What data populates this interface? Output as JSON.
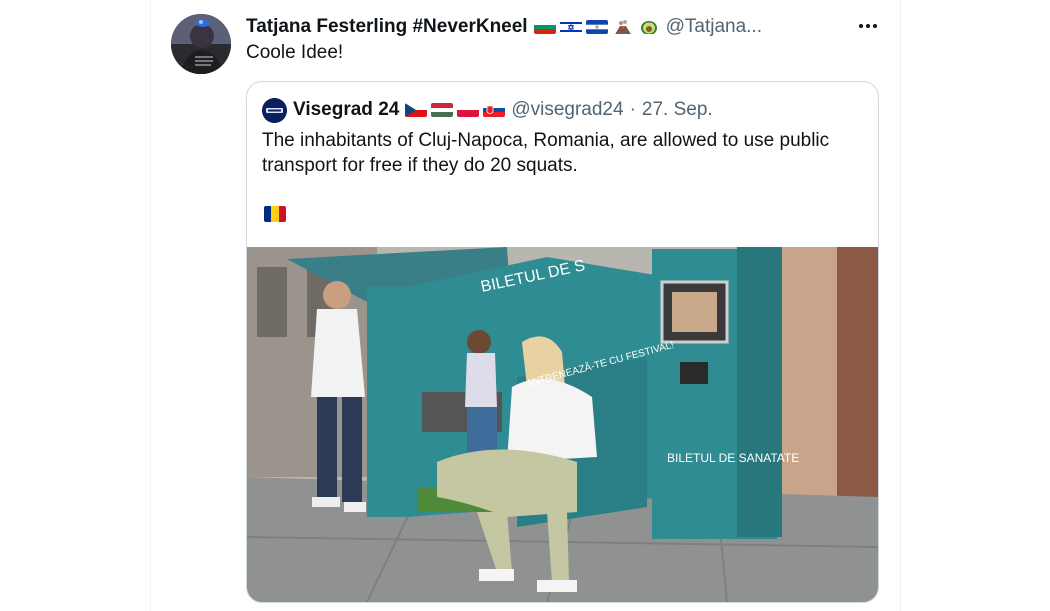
{
  "tweet": {
    "author_name": "Tatjana Festerling #NeverKneel",
    "author_handle": "@Tatjana...",
    "author_flags": [
      "bulgaria-flag",
      "israel-flag",
      "el-salvador-flag",
      "volcano-emoji",
      "avocado-emoji"
    ],
    "text": "Coole Idee!"
  },
  "quote": {
    "author_name": "Visegrad 24",
    "author_flags": [
      "czech-flag",
      "hungary-flag",
      "poland-flag",
      "slovakia-flag"
    ],
    "author_handle": "@visegrad24",
    "separator": "·",
    "date": "27. Sep.",
    "text": "The inhabitants of Cluj-Napoca, Romania, are allowed to use public transport for free if they do 20 squats.",
    "text_flag": "romania-flag",
    "image": {
      "alt": "Woman doing squats at a bus stop ticket machine",
      "sign_text": "BILETUL DE SANATATE",
      "banner_text": "BILETUL DE S",
      "poster_text": "ANTRENEAZĂ-TE CU FESTIVAL!"
    }
  },
  "colors": {
    "text": "#0f1419",
    "muted": "#536471",
    "border": "#cfd9de",
    "kiosk": "#2f8c93"
  }
}
